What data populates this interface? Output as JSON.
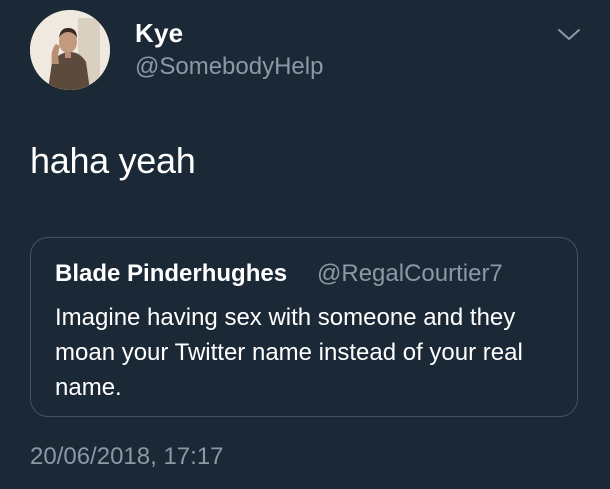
{
  "author": {
    "name": "Kye",
    "handle": "@SomebodyHelp"
  },
  "tweet": {
    "text": "haha yeah",
    "timestamp": "20/06/2018, 17:17"
  },
  "quoted_tweet": {
    "name": "Blade Pinderhughes",
    "handle": "@RegalCourtier7",
    "text": "Imagine having sex with someone and they moan your Twitter name instead of your real name."
  },
  "icons": {
    "menu": "chevron-down-icon",
    "avatar": "avatar"
  },
  "colors": {
    "background": "#1b2836",
    "primary_text": "#ffffff",
    "secondary_text": "#8b98a5",
    "quote_border": "#3d5466"
  }
}
